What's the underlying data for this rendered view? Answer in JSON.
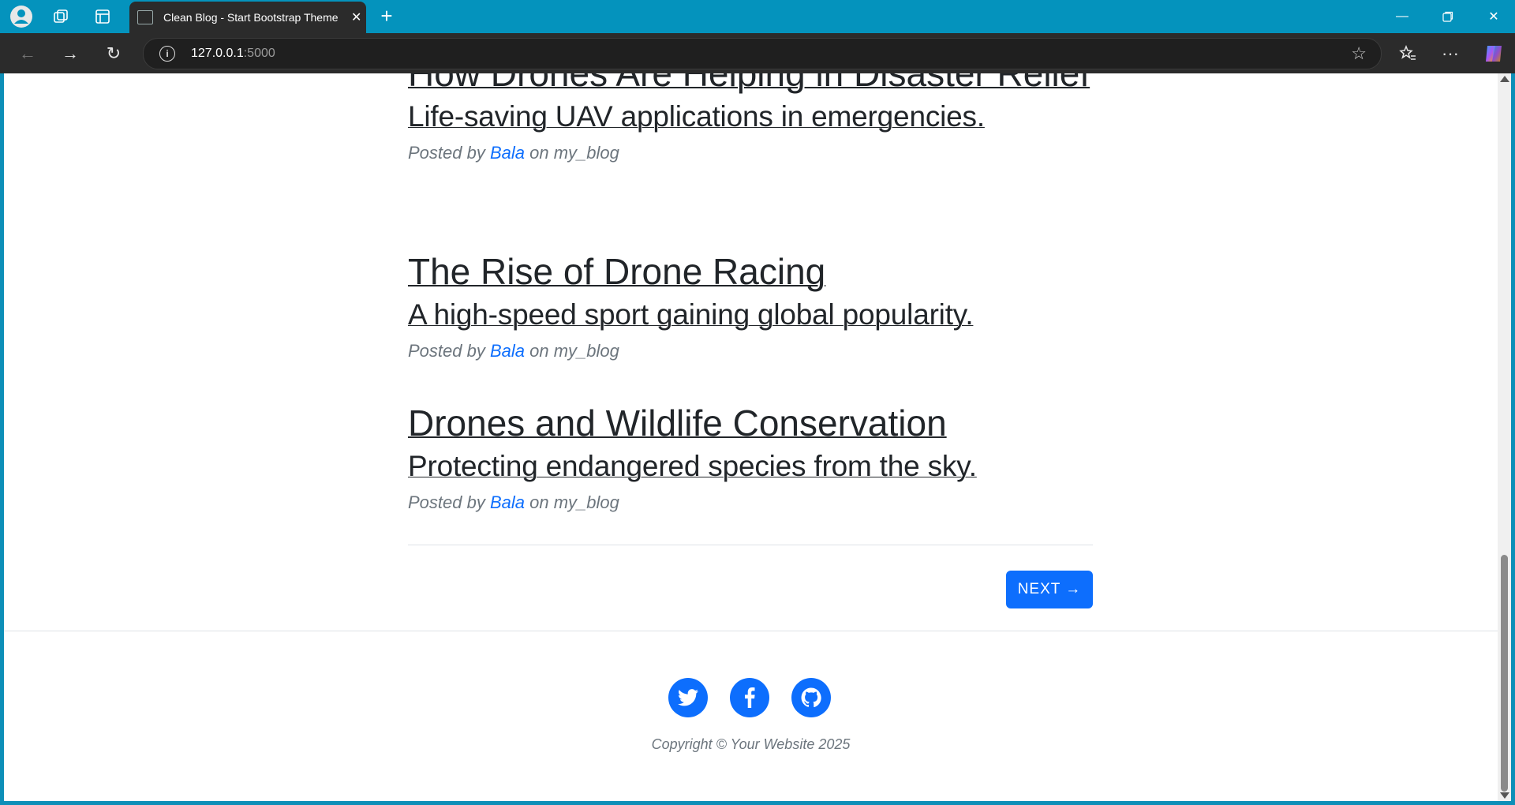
{
  "browser": {
    "tab_title": "Clean Blog - Start Bootstrap Theme",
    "url_host": "127.0.0.1",
    "url_port": ":5000"
  },
  "posts": [
    {
      "title": "How Drones Are Helping in Disaster Relief",
      "subtitle": "Life-saving UAV applications in emergencies.",
      "posted_by": "Posted by",
      "author": "Bala",
      "on_text": "on my_blog"
    },
    {
      "title": "The Rise of Drone Racing",
      "subtitle": "A high-speed sport gaining global popularity.",
      "posted_by": "Posted by",
      "author": "Bala",
      "on_text": "on my_blog"
    },
    {
      "title": "Drones and Wildlife Conservation",
      "subtitle": "Protecting endangered species from the sky.",
      "posted_by": "Posted by",
      "author": "Bala",
      "on_text": "on my_blog"
    }
  ],
  "pagination": {
    "next_label": "NEXT →"
  },
  "footer": {
    "social": [
      "twitter-icon",
      "facebook-icon",
      "github-icon"
    ],
    "copyright": "Copyright © Your Website 2025"
  },
  "colors": {
    "accent": "#0d6efd",
    "titlebar": "#0493bd",
    "text": "#212529",
    "muted": "#6c757d"
  }
}
